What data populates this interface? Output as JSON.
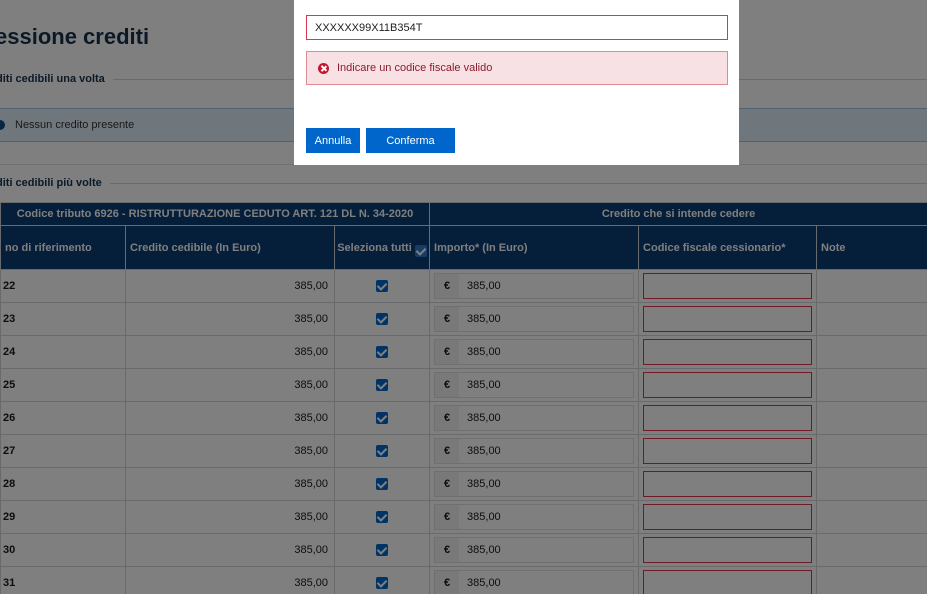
{
  "page": {
    "title": "essione crediti",
    "section_once": "diti cedibili una volta",
    "no_credit_text": "Nessun credito presente",
    "section_multiple": "diti cedibili più volte"
  },
  "table": {
    "group_left": "Codice tributo 6926 - RISTRUTTURAZIONE CEDUTO ART. 121 DL N. 34-2020",
    "group_right": "Credito che si intende cedere",
    "columns": {
      "year": "no di riferimento",
      "credit": "Credito cedibile (In Euro)",
      "select_all": "Seleziona tutti",
      "importo": "Importo* (In Euro)",
      "cf": "Codice fiscale cessionario*",
      "note": "Note"
    },
    "currency_symbol": "€",
    "rows": [
      {
        "year": "22",
        "credit": "385,00",
        "importo": "385,00"
      },
      {
        "year": "23",
        "credit": "385,00",
        "importo": "385,00"
      },
      {
        "year": "24",
        "credit": "385,00",
        "importo": "385,00"
      },
      {
        "year": "25",
        "credit": "385,00",
        "importo": "385,00"
      },
      {
        "year": "26",
        "credit": "385,00",
        "importo": "385,00"
      },
      {
        "year": "27",
        "credit": "385,00",
        "importo": "385,00"
      },
      {
        "year": "28",
        "credit": "385,00",
        "importo": "385,00"
      },
      {
        "year": "29",
        "credit": "385,00",
        "importo": "385,00"
      },
      {
        "year": "30",
        "credit": "385,00",
        "importo": "385,00"
      },
      {
        "year": "31",
        "credit": "385,00",
        "importo": "385,00"
      }
    ]
  },
  "modal": {
    "input_value": "XXXXXX99X11B354T",
    "error_text": "Indicare un codice fiscale valido",
    "cancel_label": "Annulla",
    "confirm_label": "Conferma"
  },
  "colors": {
    "primary": "#0066cc",
    "header_bg": "#0a3d73",
    "error": "#d9364f",
    "error_bg": "#f8e1e4"
  }
}
